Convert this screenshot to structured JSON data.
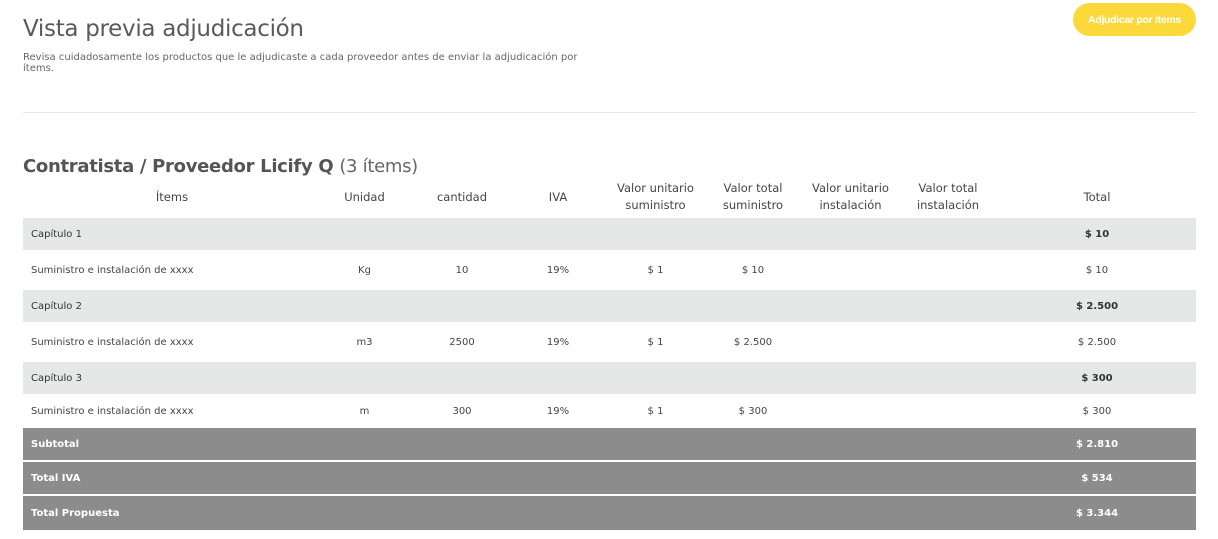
{
  "header": {
    "title": "Vista previa adjudicación",
    "subtitle": "Revisa cuidadosamente los productos que le adjudicaste a cada proveedor antes de enviar la adjudicación por ítems.",
    "action_label": "Adjudicar por ítems"
  },
  "section": {
    "title": "Contratista / Proveedor Licify Q",
    "count": "(3 ítems)"
  },
  "table": {
    "columns": {
      "items": "Ítems",
      "unidad": "Unidad",
      "cantidad": "cantidad",
      "iva": "IVA",
      "valor_unitario_suministro": "Valor unitario suministro",
      "valor_total_suministro": "Valor total suministro",
      "valor_unitario_instalacion": "Valor unitario instalación",
      "valor_total_instalacion": "Valor total instalación",
      "total": "Total"
    },
    "chapters": [
      {
        "name": "Capítulo 1",
        "total": "$ 10",
        "item": {
          "name": "Suministro e instalación de xxxx",
          "unidad": "Kg",
          "cantidad": "10",
          "iva": "19%",
          "vus": "$ 1",
          "vts": "$ 10",
          "vui": "",
          "vti": "",
          "total": "$ 10"
        }
      },
      {
        "name": "Capítulo 2",
        "total": "$ 2.500",
        "item": {
          "name": "Suministro e instalación de xxxx",
          "unidad": "m3",
          "cantidad": "2500",
          "iva": "19%",
          "vus": "$ 1",
          "vts": "$ 2.500",
          "vui": "",
          "vti": "",
          "total": "$ 2.500"
        }
      },
      {
        "name": "Capítulo 3",
        "total": "$ 300",
        "item": {
          "name": "Suministro e instalación de xxxx",
          "unidad": "m",
          "cantidad": "300",
          "iva": "19%",
          "vus": "$ 1",
          "vts": "$ 300",
          "vui": "",
          "vti": "",
          "total": "$ 300"
        }
      }
    ],
    "totals": {
      "subtotal_label": "Subtotal",
      "subtotal_value": "$ 2.810",
      "iva_label": "Total IVA",
      "iva_value": "$ 534",
      "propuesta_label": "Total Propuesta",
      "propuesta_value": "$ 3.344"
    }
  },
  "colors": {
    "accent": "#fcd93b",
    "chapter_row_bg": "#e6e7e7",
    "totals_bg": "#8c8c8c"
  }
}
